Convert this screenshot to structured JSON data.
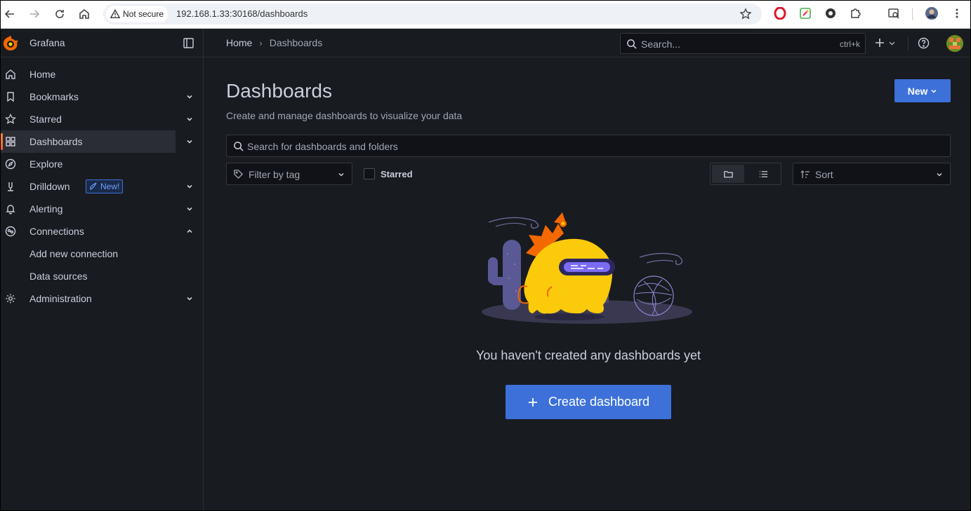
{
  "browser": {
    "security_label": "Not secure",
    "url": "192.168.1.33:30168/dashboards"
  },
  "topbar": {
    "brand": "Grafana",
    "breadcrumb": {
      "home": "Home",
      "separator": "›",
      "current": "Dashboards"
    },
    "search": {
      "placeholder": "Search...",
      "shortcut": "ctrl+k"
    }
  },
  "sidebar": {
    "items": [
      {
        "label": "Home",
        "icon": "home-icon"
      },
      {
        "label": "Bookmarks",
        "icon": "bookmark-icon"
      },
      {
        "label": "Starred",
        "icon": "star-icon"
      },
      {
        "label": "Dashboards",
        "icon": "apps-icon",
        "active": true
      },
      {
        "label": "Explore",
        "icon": "compass-icon"
      },
      {
        "label": "Drilldown",
        "icon": "drilldown-icon",
        "badge": "New!"
      },
      {
        "label": "Alerting",
        "icon": "bell-icon"
      },
      {
        "label": "Connections",
        "icon": "connections-icon",
        "expanded": true
      },
      {
        "label": "Add new connection"
      },
      {
        "label": "Data sources"
      },
      {
        "label": "Administration",
        "icon": "cog-icon"
      }
    ]
  },
  "main": {
    "title": "Dashboards",
    "subtitle": "Create and manage dashboards to visualize your data",
    "new_button": "New",
    "search_placeholder": "Search for dashboards and folders",
    "filter_tag_placeholder": "Filter by tag",
    "starred_label": "Starred",
    "sort_placeholder": "Sort",
    "empty_message": "You haven't created any dashboards yet",
    "create_button": "Create dashboard"
  },
  "colors": {
    "background": "#181b1f",
    "primary": "#3d71d9",
    "text": "#ccccdc",
    "muted": "#9fa7b3",
    "accent_orange": "#f55f3e"
  }
}
